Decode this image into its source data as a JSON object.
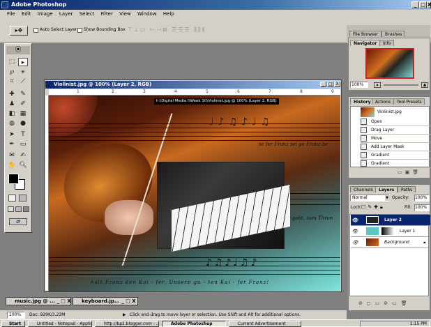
{
  "app": {
    "title": "Adobe Photoshop",
    "controls": [
      "_",
      "□",
      "X"
    ]
  },
  "menu": [
    "File",
    "Edit",
    "Image",
    "Layer",
    "Select",
    "Filter",
    "View",
    "Window",
    "Help"
  ],
  "options": {
    "auto_select": "Auto Select Layer",
    "bounding": "Show Bounding Box"
  },
  "document": {
    "title": "Violinist.jpg @ 100% (Layer 2, RGB)",
    "tooltip": "h:\\Digital Media I\\Week 10\\Violinist.jpg @ 100% (Layer 2, RGB)",
    "ruler": [
      "1",
      "2",
      "3",
      "4",
      "5",
      "6",
      "7",
      "8",
      "9"
    ],
    "lyrics": "halt Franz den Kai - fer, Unsern gu - ten Kai - fer Franz!",
    "lyrics2": "Er geht, zum Thron",
    "lyrics3": "ne fer Franz sei ge Franz be"
  },
  "navigator": {
    "tabs": [
      "Navigator",
      "Info"
    ],
    "top_tabs": [
      "File Browser",
      "Brushes"
    ],
    "zoom": "100%"
  },
  "history": {
    "tabs": [
      "History",
      "Actions",
      "Tool Presets"
    ],
    "snapshot": "Violinist.jpg",
    "items": [
      "Open",
      "Drag Layer",
      "Move",
      "Add Layer Mask",
      "Gradient",
      "Gradient"
    ]
  },
  "layers": {
    "tabs": [
      "Channels",
      "Layers",
      "Paths"
    ],
    "blend": "Normal",
    "opacity_label": "Opacity:",
    "opacity": "100%",
    "lock_label": "Lock:",
    "fill_label": "Fill:",
    "fill": "100%",
    "items": [
      "Layer 2",
      "Layer 1",
      "Background"
    ]
  },
  "status": {
    "zoom": "100%",
    "doc": "Doc: 929K/3.23M",
    "hint": "Click and drag to move layer or selection. Use Shift and Alt for additional options."
  },
  "minimized": [
    {
      "label": "music.jpg @ ...",
      "ctrl": "_ □ X"
    },
    {
      "label": "keyboard.jp...",
      "ctrl": "_ □ X"
    }
  ],
  "taskbar": {
    "start": "Start",
    "items": [
      "Untitled - Notepad - Applicati...",
      "http://bp2.blogger.com - ...",
      "Adobe Photoshop",
      "Current Advertisement"
    ],
    "clock": "1:15 PM"
  }
}
